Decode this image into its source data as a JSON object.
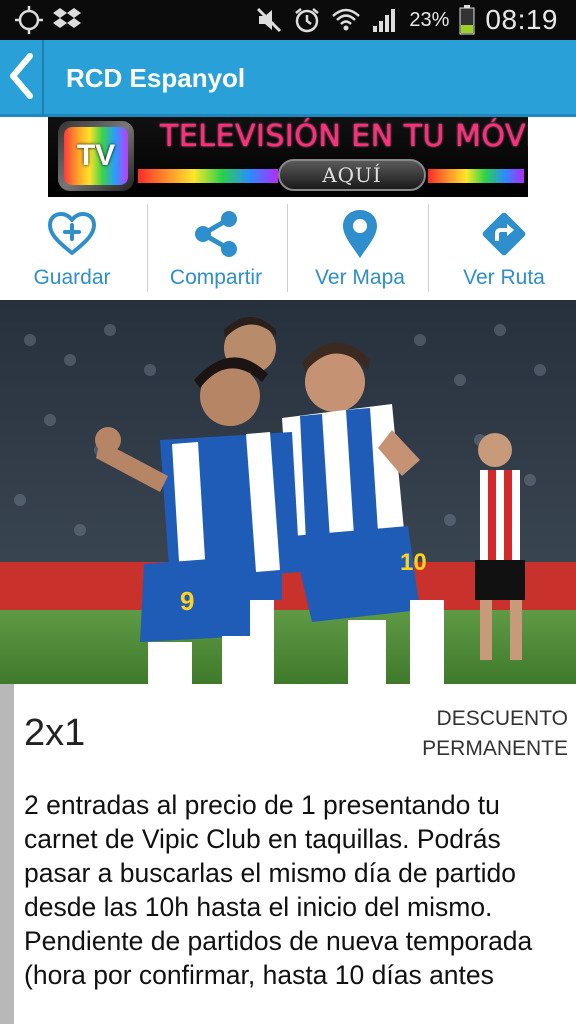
{
  "status_bar": {
    "battery_percent": "23%",
    "time": "08:19",
    "icons": [
      "gps-icon",
      "dropbox-icon",
      "mute-icon",
      "alarm-icon",
      "wifi-icon",
      "signal-icon",
      "battery-icon"
    ]
  },
  "app_bar": {
    "title": "RCD Espanyol",
    "back_icon": "chevron-left-icon",
    "color": "#2aa0d8"
  },
  "banner": {
    "logo_text": "TV",
    "headline": "TELEVISIÓN EN TU MÓVIL",
    "button_text": "AQUÍ"
  },
  "actions": [
    {
      "label": "Guardar",
      "icon": "heart-plus-icon"
    },
    {
      "label": "Compartir",
      "icon": "share-icon"
    },
    {
      "label": "Ver Mapa",
      "icon": "map-pin-icon"
    },
    {
      "label": "Ver Ruta",
      "icon": "directions-icon"
    }
  ],
  "accent_color": "#2e8fcc",
  "offer": {
    "title": "2x1",
    "type_line1": "DESCUENTO",
    "type_line2": "PERMANENTE",
    "description": "2 entradas al precio de 1 presentando tu carnet de Vipic Club en taquillas. Podrás pasar a buscarlas el mismo día de partido desde las 10h hasta el inicio del mismo.\nPendiente de partidos de nueva temporada\n(hora por confirmar, hasta 10 días antes"
  }
}
